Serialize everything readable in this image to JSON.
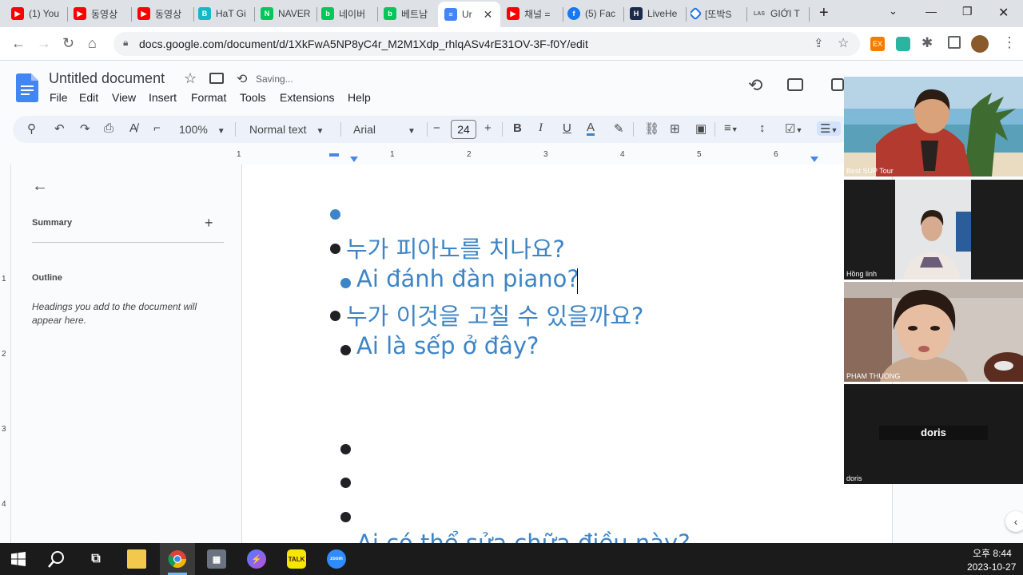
{
  "browser": {
    "tabs": [
      {
        "label": "(1) You",
        "icon": "youtube-icon",
        "color": "#ff0000"
      },
      {
        "label": "동영상",
        "icon": "youtube-icon",
        "color": "#ff0000"
      },
      {
        "label": "동영상",
        "icon": "youtube-icon",
        "color": "#ff0000"
      },
      {
        "label": "HaT Gi",
        "icon": "b-icon",
        "color": "#14b8c8"
      },
      {
        "label": "NAVER",
        "icon": "naver-icon",
        "color": "#03c75a"
      },
      {
        "label": "네이버",
        "icon": "blog-icon",
        "color": "#03c75a"
      },
      {
        "label": "베트남",
        "icon": "blog-icon",
        "color": "#03c75a"
      },
      {
        "label": "Ur",
        "icon": "docs-icon",
        "color": "#4285f4"
      },
      {
        "label": "채널 =",
        "icon": "youtube-icon",
        "color": "#ff0000"
      },
      {
        "label": "(5) Fac",
        "icon": "facebook-icon",
        "color": "#1877f2"
      },
      {
        "label": "LiveHe",
        "icon": "livehe-icon",
        "color": "#1b2a4a"
      },
      {
        "label": "[또박S",
        "icon": "diamond-icon",
        "color": "#1a73e8"
      },
      {
        "label": "GIỚI T",
        "icon": "las-icon",
        "color": "#5f6368"
      }
    ],
    "url": "docs.google.com/document/d/1XkFwA5NP8yC4r_M2M1Xdp_rhlqASv4rE31OV-3F-f0Y/edit"
  },
  "docs": {
    "title": "Untitled document",
    "status": "Saving...",
    "menu": [
      "File",
      "Edit",
      "View",
      "Insert",
      "Format",
      "Tools",
      "Extensions",
      "Help"
    ],
    "toolbar": {
      "zoom": "100%",
      "style": "Normal text",
      "font": "Arial",
      "font_size": "24"
    },
    "ruler_numbers": [
      "1",
      "1",
      "2",
      "3",
      "4",
      "5",
      "6"
    ],
    "vruler_numbers": [
      "1",
      "2",
      "3",
      "4"
    ],
    "outline_panel": {
      "summary_label": "Summary",
      "outline_label": "Outline",
      "hint": "Headings you add to the document will appear here."
    },
    "lines": [
      {
        "text": "",
        "bullet": "blue"
      },
      {
        "text": "누가 피아노를 치나요?",
        "bullet": "black"
      },
      {
        "text": "Ai đánh đàn piano?",
        "bullet": "blue"
      },
      {
        "text": "누가 이것을 고칠 수 있을까요?",
        "bullet": "black"
      },
      {
        "text": "Ai là sếp ở đây?",
        "bullet": "black"
      },
      {
        "text": "",
        "bullet": "black"
      },
      {
        "text": "",
        "bullet": "black"
      },
      {
        "text": "",
        "bullet": "black"
      },
      {
        "text": "Ai có thể sửa chữa điều này?",
        "bullet": "none"
      }
    ]
  },
  "meeting": {
    "participants": [
      {
        "name": "Best SUP Tour"
      },
      {
        "name": "Hồng linh"
      },
      {
        "name": "PHAM THUONG"
      },
      {
        "name": "doris",
        "center_label": "doris"
      }
    ]
  },
  "taskbar": {
    "time": "오후 8:44",
    "date": "2023-10-27"
  }
}
